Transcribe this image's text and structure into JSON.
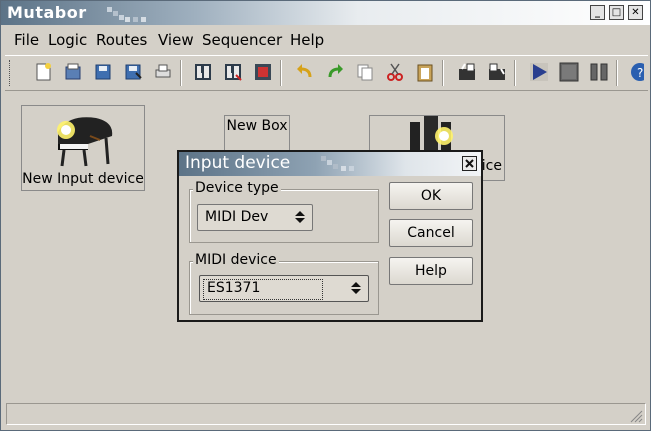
{
  "window": {
    "title": "Mutabor"
  },
  "menu": [
    {
      "label": "File"
    },
    {
      "label": "Logic"
    },
    {
      "label": "Routes"
    },
    {
      "label": "View"
    },
    {
      "label": "Sequencer"
    },
    {
      "label": "Help"
    }
  ],
  "toolbar": {
    "icons": [
      "new-file-icon",
      "open-file-icon",
      "save-icon",
      "save-as-icon",
      "print-icon",
      "activate-icon",
      "deactivate-icon",
      "panic-icon",
      "undo-icon",
      "redo-icon",
      "copy-icon",
      "cut-icon",
      "paste-icon",
      "route-load-icon",
      "route-save-icon",
      "play-icon",
      "stop-icon",
      "pause-icon",
      "help-icon"
    ]
  },
  "canvas": {
    "input_box": {
      "label": "New Input device"
    },
    "new_box": {
      "label": "New Box"
    },
    "output_box": {
      "label": "ice"
    }
  },
  "dialog": {
    "title": "Input device",
    "device_type": {
      "label": "Device type",
      "value": "MIDI Dev"
    },
    "midi_device": {
      "label": "MIDI device",
      "value": "ES1371"
    },
    "buttons": {
      "ok": "OK",
      "cancel": "Cancel",
      "help": "Help"
    }
  },
  "colors": {
    "titlebar": "#5c7387",
    "background": "#d4d0c8",
    "play_blue": "#2a3f8f"
  }
}
